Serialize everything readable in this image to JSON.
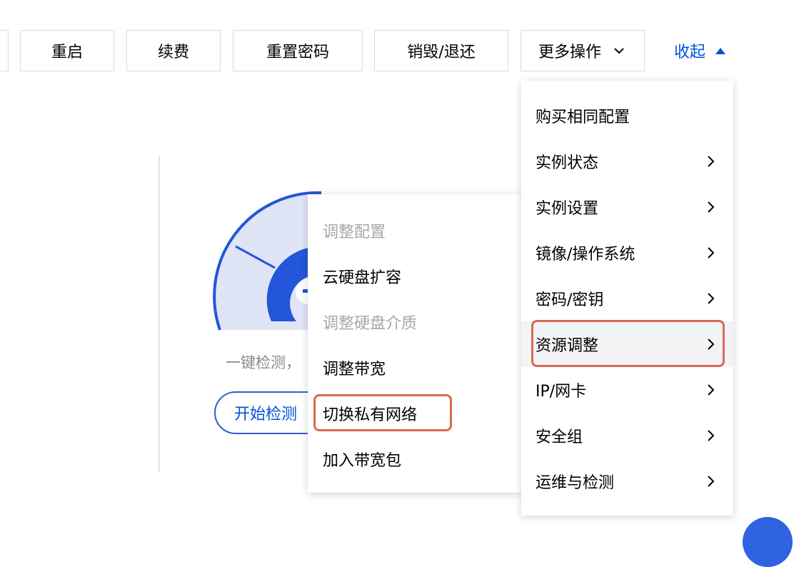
{
  "toolbar": {
    "buttons": [
      "重启",
      "续费",
      "重置密码",
      "销毁/退还"
    ],
    "more_label": "更多操作",
    "collapse_label": "收起"
  },
  "check_panel": {
    "hint_text": "一键检测，",
    "start_button": "开始检测"
  },
  "more_menu": {
    "items": [
      "购买相同配置",
      "实例状态",
      "实例设置",
      "镜像/操作系统",
      "密码/密钥",
      "资源调整",
      "IP/网卡",
      "安全组",
      "运维与检测"
    ]
  },
  "resource_submenu": {
    "items": [
      "调整配置",
      "云硬盘扩容",
      "调整硬盘介质",
      "调整带宽",
      "切换私有网络",
      "加入带宽包"
    ]
  },
  "colors": {
    "accent": "#0052d9",
    "highlight_box": "#d86a52",
    "gauge_light": "#dfe5f7",
    "gauge_dark": "#2456d9"
  }
}
